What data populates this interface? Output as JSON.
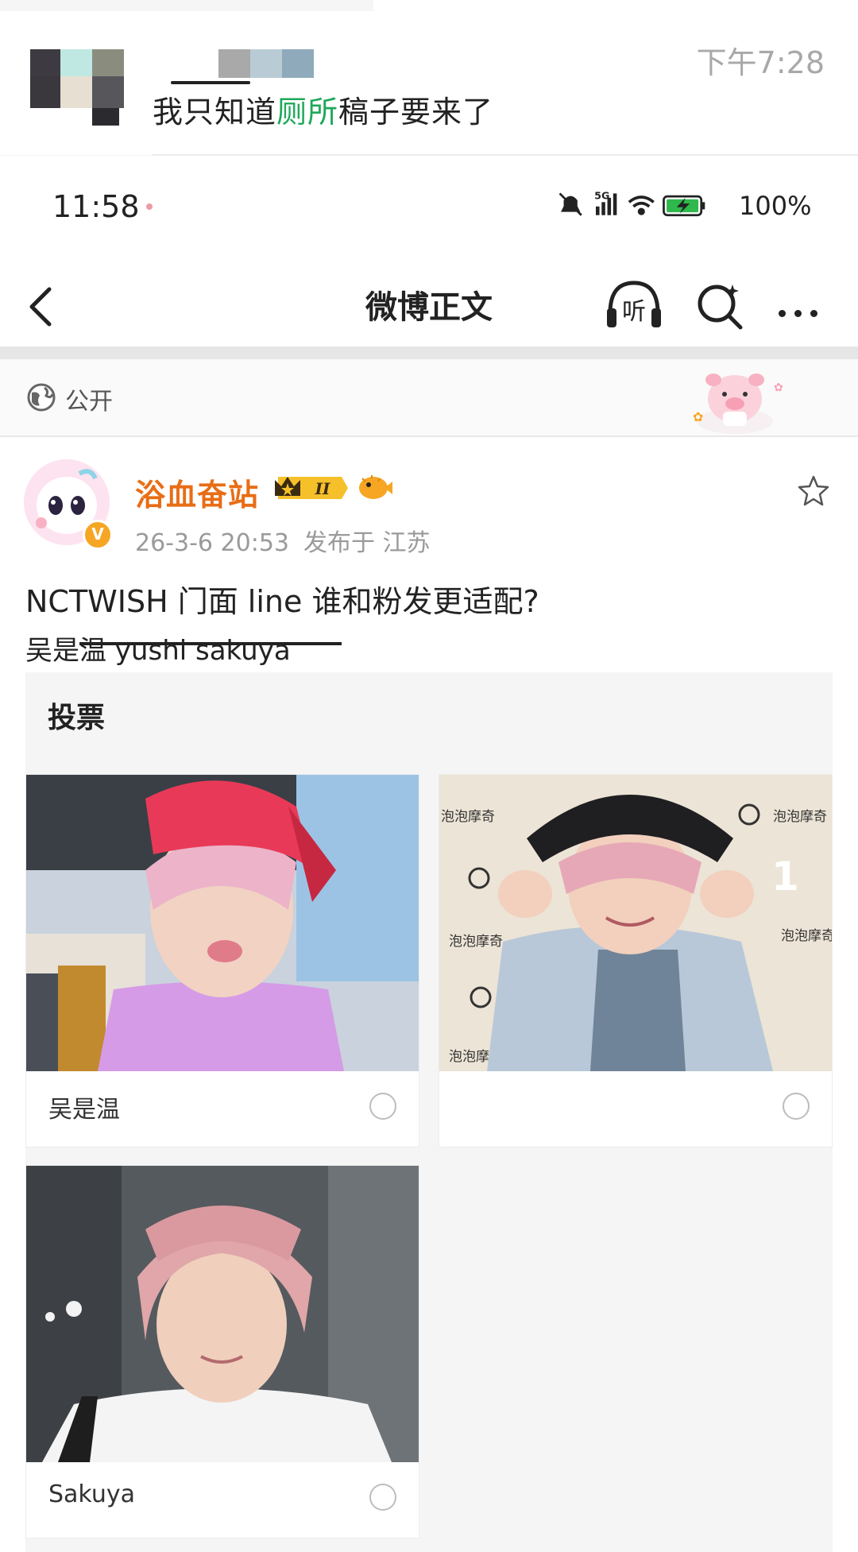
{
  "chat": {
    "message_prefix": "我只知道",
    "message_highlight": "厕所",
    "message_suffix": "稿子要来了",
    "time": "下午7:28"
  },
  "status_bar": {
    "time": "11:58",
    "network": "5G",
    "battery": "100%"
  },
  "nav": {
    "title": "微博正文",
    "listen_label": "听"
  },
  "visibility": {
    "label": "公开"
  },
  "post": {
    "author": "浴血奋站",
    "level_badge": "II",
    "verified_mark": "V",
    "date": "26-3-6 20:53",
    "location": "发布于 江苏",
    "line1": "NCTWISH 门面 line 谁和粉发更适配?",
    "line2": "吴是温 yushi sakuya"
  },
  "vote": {
    "title": "投票",
    "options": [
      {
        "label": "吴是温"
      },
      {
        "label": ""
      },
      {
        "label": "Sakuya"
      }
    ],
    "bg_text": [
      "泡泡摩奇",
      "泡泡摩奇",
      "泡泡摩奇",
      "泡泡摩奇",
      "泡泡摩奇",
      "1"
    ]
  },
  "colors": {
    "author": "#e86d16",
    "highlight": "#1ea85a",
    "badge": "#f6a623"
  }
}
